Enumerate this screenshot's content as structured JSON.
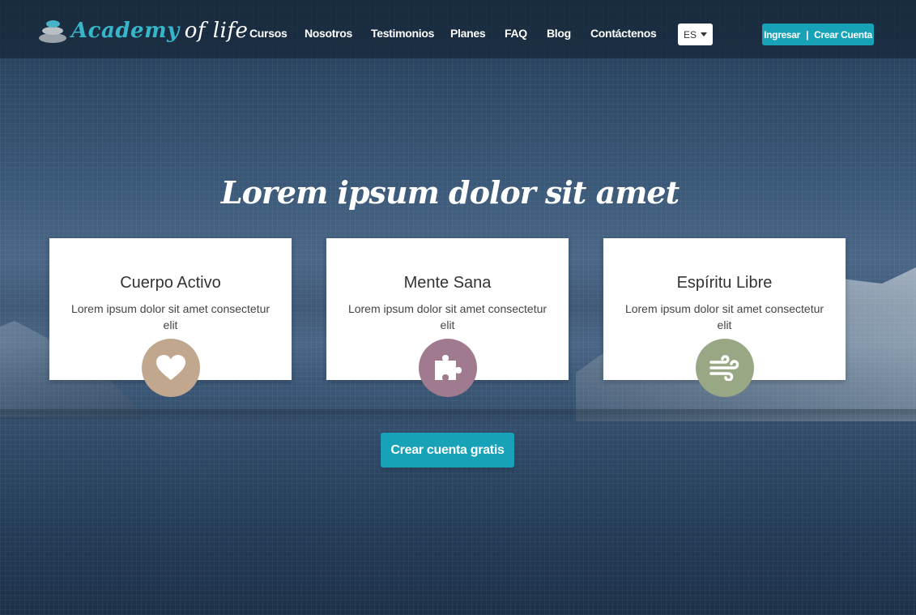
{
  "header": {
    "logo_primary": "Academy",
    "logo_secondary": "of life",
    "nav": [
      "Cursos",
      "Nosotros",
      "Testimonios",
      "Planes",
      "FAQ",
      "Blog",
      "Contáctenos"
    ],
    "language": "ES",
    "login_label": "Ingresar",
    "separator": "|",
    "signup_label": "Crear Cuenta"
  },
  "hero": {
    "title": "Lorem ipsum dolor sit amet"
  },
  "cards": [
    {
      "title": "Cuerpo Activo",
      "text": "Lorem ipsum dolor sit amet consectetur elit",
      "icon": "heart-icon",
      "color": "#c2a78f"
    },
    {
      "title": "Mente Sana",
      "text": "Lorem ipsum dolor sit amet consectetur elit",
      "icon": "puzzle-icon",
      "color": "#a07a8e"
    },
    {
      "title": "Espíritu Libre",
      "text": "Lorem ipsum dolor sit amet consectetur elit",
      "icon": "wind-icon",
      "color": "#98a884"
    }
  ],
  "cta": {
    "label": "Crear cuenta gratis"
  },
  "colors": {
    "accent": "#17a2b8",
    "logo": "#37b5c9"
  }
}
